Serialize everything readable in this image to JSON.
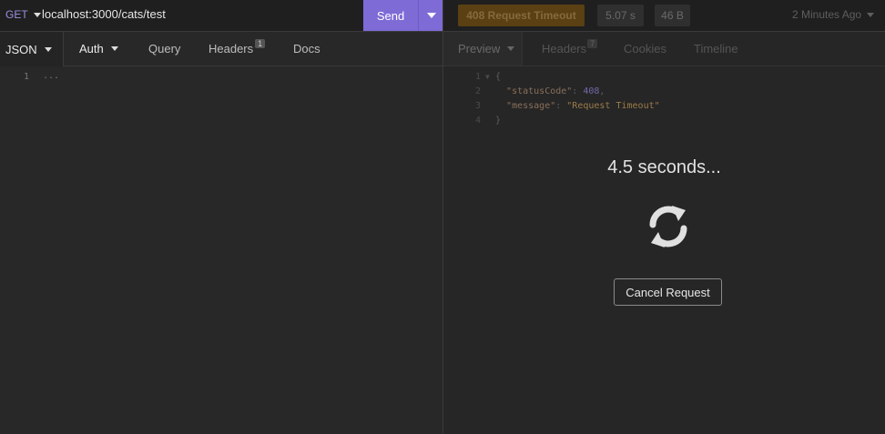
{
  "request": {
    "method": "GET",
    "url": "localhost:3000/cats/test",
    "send_label": "Send",
    "tabs": {
      "body": "JSON",
      "auth": "Auth",
      "query": "Query",
      "headers": "Headers",
      "headers_count": "1",
      "docs": "Docs"
    },
    "editor": {
      "line": "1",
      "content": "..."
    }
  },
  "response": {
    "status": "408 Request Timeout",
    "time": "5.07 s",
    "size": "46 B",
    "ago": "2 Minutes Ago",
    "tabs": {
      "preview": "Preview",
      "headers": "Headers",
      "headers_count": "7",
      "cookies": "Cookies",
      "timeline": "Timeline"
    },
    "preview_lines": [
      {
        "num": "1",
        "text": "{"
      },
      {
        "num": "2",
        "key": "\"statusCode\"",
        "sep": ": ",
        "value": "408",
        "trail": ","
      },
      {
        "num": "3",
        "key": "\"message\"",
        "sep": ": ",
        "value": "\"Request Timeout\""
      },
      {
        "num": "4",
        "text": "}"
      }
    ],
    "loading": {
      "timer": "4.5 seconds...",
      "cancel_label": "Cancel Request",
      "icon": "sync-icon"
    }
  },
  "colors": {
    "send": "#7e6bd6",
    "method": "#9d8fe0",
    "status_bg": "#5a4012"
  }
}
